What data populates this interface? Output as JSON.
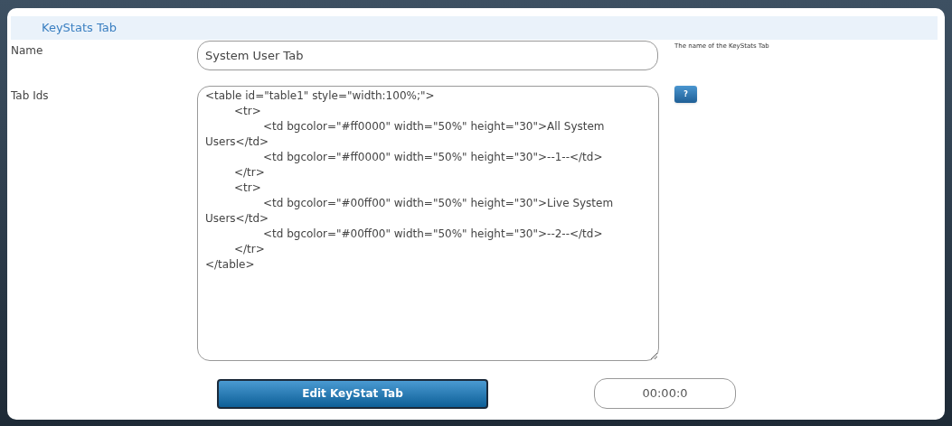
{
  "header": {
    "title": "KeyStats Tab"
  },
  "fields": [
    {
      "label": "Name",
      "value": "System User Tab",
      "hint": "The name of the KeyStats Tab"
    },
    {
      "label": "Tab Ids",
      "value": "<table id=\"table1\" style=\"width:100%;\">\n\t<tr>\n\t\t<td bgcolor=\"#ff0000\" width=\"50%\" height=\"30\">All System Users</td>\n\t\t<td bgcolor=\"#ff0000\" width=\"50%\" height=\"30\">--1--</td>\n\t</tr>\n\t<tr>\n\t\t<td bgcolor=\"#00ff00\" width=\"50%\" height=\"30\">Live System Users</td>\n\t\t<td bgcolor=\"#00ff00\" width=\"50%\" height=\"30\">--2--</td>\n\t</tr>\n</table>",
      "help": "?"
    }
  ],
  "submit": "Edit KeyStat Tab",
  "timer": "00:00:0"
}
